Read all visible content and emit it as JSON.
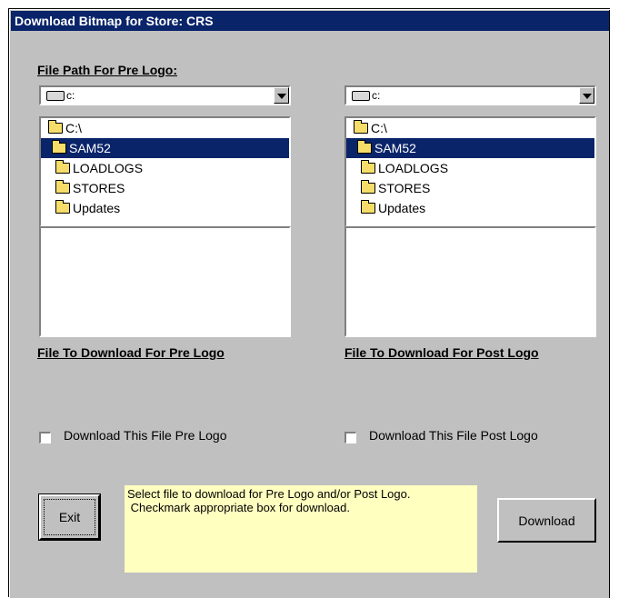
{
  "window": {
    "title": "Download Bitmap for Store: CRS"
  },
  "pre": {
    "path_label": "File Path For Pre Logo:",
    "drive": "c:",
    "folders": [
      {
        "label": "C:\\",
        "selected": false,
        "level": 0,
        "open": true
      },
      {
        "label": "SAM52",
        "selected": true,
        "level": 1,
        "open": true
      },
      {
        "label": "LOADLOGS",
        "selected": false,
        "level": 2,
        "open": false
      },
      {
        "label": "STORES",
        "selected": false,
        "level": 2,
        "open": false
      },
      {
        "label": "Updates",
        "selected": false,
        "level": 2,
        "open": false
      }
    ],
    "file_label": "File To Download For Pre Logo",
    "checkbox_label": "Download This File Pre Logo",
    "checked": false
  },
  "post": {
    "drive": "c:",
    "folders": [
      {
        "label": "C:\\",
        "selected": false,
        "level": 0,
        "open": true
      },
      {
        "label": "SAM52",
        "selected": true,
        "level": 1,
        "open": true
      },
      {
        "label": "LOADLOGS",
        "selected": false,
        "level": 2,
        "open": false
      },
      {
        "label": "STORES",
        "selected": false,
        "level": 2,
        "open": false
      },
      {
        "label": "Updates",
        "selected": false,
        "level": 2,
        "open": false
      }
    ],
    "file_label": "File To Download For Post Logo",
    "checkbox_label": "Download This File Post Logo",
    "checked": false
  },
  "buttons": {
    "exit": "Exit",
    "download": "Download"
  },
  "info": {
    "line1": "Select file to download for Pre Logo and/or Post Logo.",
    "line2": " Checkmark appropriate box for download."
  },
  "colors": {
    "titlebar": "#0a246a",
    "selection": "#0a246a",
    "window_bg": "#c0c0c0",
    "info_bg": "#ffffc0",
    "folder": "#f6dd6a"
  }
}
